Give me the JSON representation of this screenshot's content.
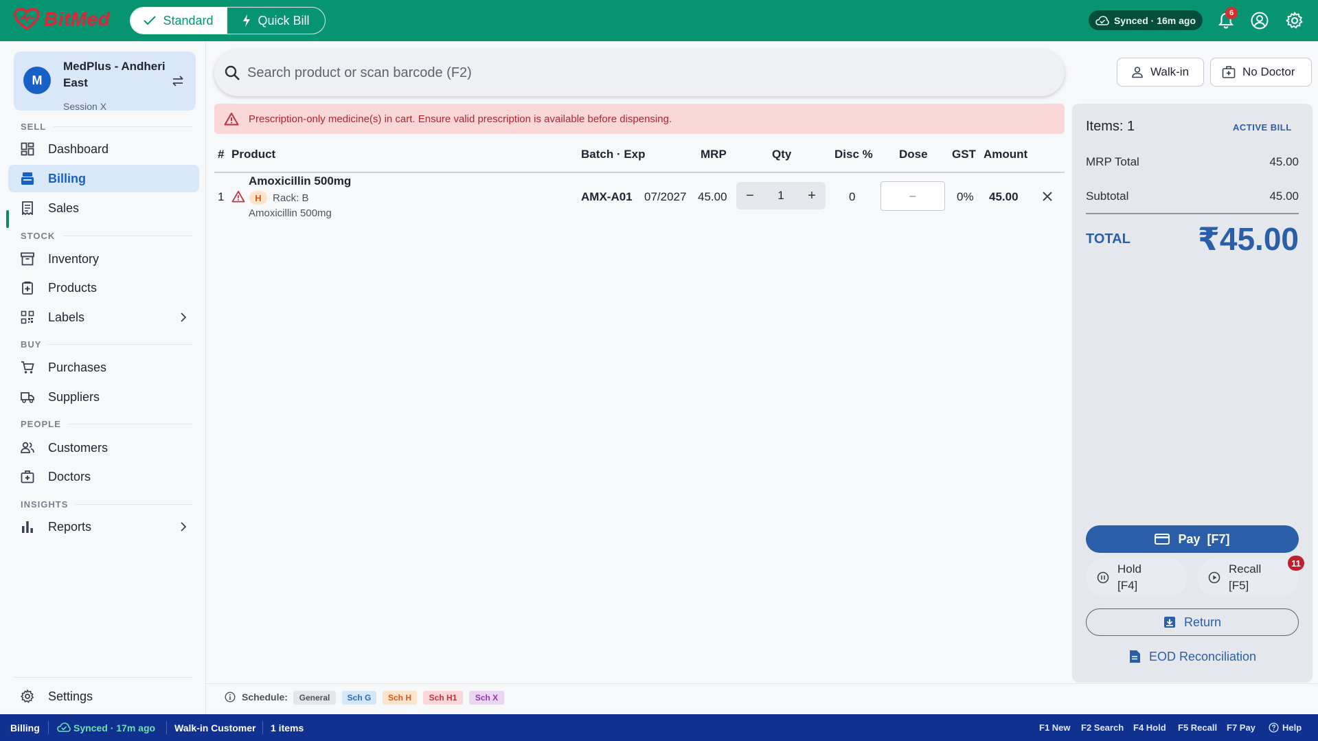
{
  "app": {
    "logo_text": "BitMed",
    "brand_color": "#079470",
    "alert_color": "#b4232c"
  },
  "header": {
    "modes": [
      {
        "label": "Standard",
        "icon": "check-icon",
        "active": true
      },
      {
        "label": "Quick Bill",
        "icon": "bolt-icon",
        "active": false
      }
    ],
    "sync_status": "Synced · 16m ago",
    "notification_count": "6"
  },
  "sidebar": {
    "store": {
      "avatar": "M",
      "name": "MedPlus - Andheri East",
      "session": "Session X"
    },
    "sections": [
      {
        "title": "SELL",
        "items": [
          {
            "label": "Dashboard",
            "icon": "dashboard-icon"
          },
          {
            "label": "Billing",
            "icon": "billing-icon",
            "active": true
          },
          {
            "label": "Sales",
            "icon": "receipt-icon"
          }
        ]
      },
      {
        "title": "STOCK",
        "items": [
          {
            "label": "Inventory",
            "icon": "inventory-icon"
          },
          {
            "label": "Products",
            "icon": "product-icon"
          },
          {
            "label": "Labels",
            "icon": "qr-icon",
            "has_children": true
          }
        ]
      },
      {
        "title": "BUY",
        "items": [
          {
            "label": "Purchases",
            "icon": "cart-icon"
          },
          {
            "label": "Suppliers",
            "icon": "truck-icon"
          }
        ]
      },
      {
        "title": "PEOPLE",
        "items": [
          {
            "label": "Customers",
            "icon": "people-icon"
          },
          {
            "label": "Doctors",
            "icon": "doctor-icon"
          }
        ]
      },
      {
        "title": "INSIGHTS",
        "items": [
          {
            "label": "Reports",
            "icon": "chart-icon",
            "has_children": true
          }
        ]
      }
    ],
    "settings_label": "Settings"
  },
  "main": {
    "search_placeholder": "Search product or scan barcode (F2)",
    "customer_button": "Walk-in",
    "doctor_button": "No Doctor",
    "alert_text": "Prescription-only medicine(s) in cart. Ensure valid prescription is available before dispensing.",
    "columns": [
      "#",
      "Product",
      "Batch · Exp",
      "MRP",
      "Qty",
      "Disc %",
      "Dose",
      "GST",
      "Amount"
    ],
    "rows": [
      {
        "index": "1",
        "name": "Amoxicillin 500mg",
        "schedule": "H",
        "rack": "Rack: B",
        "generic": "Amoxicillin 500mg",
        "batch": "AMX-A01",
        "exp": "07/2027",
        "mrp": "45.00",
        "qty": "1",
        "disc": "0",
        "dose_placeholder": "–",
        "gst": "0%",
        "amount": "45.00"
      }
    ]
  },
  "bill": {
    "items_label": "Items: 1",
    "status": "ACTIVE BILL",
    "mrp_total_label": "MRP Total",
    "mrp_total": "45.00",
    "subtotal_label": "Subtotal",
    "subtotal": "45.00",
    "total_label": "TOTAL",
    "total": "₹45.00",
    "pay_label": "Pay  [F7]",
    "hold_label": "Hold [F4]",
    "recall_label": "Recall [F5]",
    "recall_count": "11",
    "return_label": "Return",
    "eod_label": "EOD Reconciliation"
  },
  "legend": {
    "label": "Schedule:",
    "chips": [
      {
        "label": "General",
        "bg": "#e4e6ea",
        "fg": "#4b525d"
      },
      {
        "label": "Sch G",
        "bg": "#d3e6fa",
        "fg": "#2b6bb8"
      },
      {
        "label": "Sch H",
        "bg": "#fde3c9",
        "fg": "#d9571e"
      },
      {
        "label": "Sch H1",
        "bg": "#f9d6d8",
        "fg": "#c0303e"
      },
      {
        "label": "Sch X",
        "bg": "#ead6f3",
        "fg": "#8e3aa8"
      }
    ]
  },
  "statusbar": {
    "page": "Billing",
    "sync": "Synced · 17m ago",
    "customer": "Walk-in Customer",
    "items": "1 items",
    "shortcuts": [
      "F1 New",
      "F2 Search",
      "F4 Hold",
      "F5 Recall",
      "F7 Pay"
    ],
    "help": "Help"
  }
}
